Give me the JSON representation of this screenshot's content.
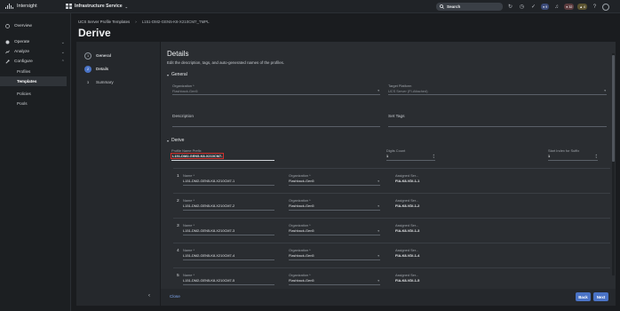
{
  "topbar": {
    "brand": "Intersight",
    "service": "Infrastructure Service",
    "search_label": "Search",
    "badges": [
      {
        "count": "32",
        "kind": "alarm-critical"
      },
      {
        "count": "4",
        "kind": "alarm-warning"
      },
      {
        "count": "9",
        "kind": "tasks"
      }
    ]
  },
  "sidebar": {
    "overview": "Overview",
    "operate": "Operate",
    "analyze": "Analyze",
    "configure": "Configure",
    "sub": [
      "Profiles",
      "Templates",
      "Policies",
      "Pools"
    ]
  },
  "breadcrumb": {
    "parent": "UCS Server Profile Templates",
    "current": "L151-DM2-GEN5-K8-X210CM7_TMPL"
  },
  "page_title": "Derive",
  "steps": [
    {
      "num": "1",
      "label": "General"
    },
    {
      "num": "2",
      "label": "Details"
    },
    {
      "num": "3",
      "label": "Summary"
    }
  ],
  "details": {
    "title": "Details",
    "subtitle": "Edit the description, tags, and auto-generated names of the profiles.",
    "general_section": "General",
    "organization_label": "Organization *",
    "organization_value": "Flashback-Gen5",
    "target_platform_label": "Target Platform",
    "target_platform_value": "UCS Server (FI-Attached)",
    "description_label": "Description",
    "set_tags_label": "Set Tags",
    "derive_section": "Derive",
    "prefix_label": "Profile Name Prefix",
    "prefix_value": "L151-DM2-GEN5-K8-X210CM7-",
    "digits_label": "Digits Count",
    "digits_value": "1",
    "start_index_label": "Start Index for Suffix",
    "start_index_value": "1"
  },
  "rows": [
    {
      "num": "1",
      "name_label": "Name *",
      "name": "L151-DM2-GEN5-K8-X210CM7-1",
      "org_label": "Organization *",
      "org": "Flashback-Gen5",
      "assigned_label": "Assigned Ser...",
      "assigned": "FIA-K8-VDI-1-1"
    },
    {
      "num": "2",
      "name_label": "Name *",
      "name": "L151-DM2-GEN5-K8-X210CM7-2",
      "org_label": "Organization *",
      "org": "Flashback-Gen5",
      "assigned_label": "Assigned Ser...",
      "assigned": "FIA-K8-VDI-1-2"
    },
    {
      "num": "3",
      "name_label": "Name *",
      "name": "L151-DM2-GEN5-K8-X210CM7-3",
      "org_label": "Organization *",
      "org": "Flashback-Gen5",
      "assigned_label": "Assigned Ser...",
      "assigned": "FIA-K8-VDI-1-3"
    },
    {
      "num": "4",
      "name_label": "Name *",
      "name": "L151-DM2-GEN5-K8-X210CM7-4",
      "org_label": "Organization *",
      "org": "Flashback-Gen5",
      "assigned_label": "Assigned Ser...",
      "assigned": "FIA-K8-VDI-1-4"
    },
    {
      "num": "5",
      "name_label": "Name *",
      "name": "L151-DM2-GEN5-K8-X210CM7-5",
      "org_label": "Organization *",
      "org": "Flashback-Gen5",
      "assigned_label": "Assigned Ser...",
      "assigned": "FIA-K8-VDI-1-5"
    }
  ],
  "footer": {
    "close": "Close",
    "back": "Back",
    "next": "Next"
  },
  "colors": {
    "accent": "#4a73c6",
    "highlight_box": "#d0312d"
  }
}
